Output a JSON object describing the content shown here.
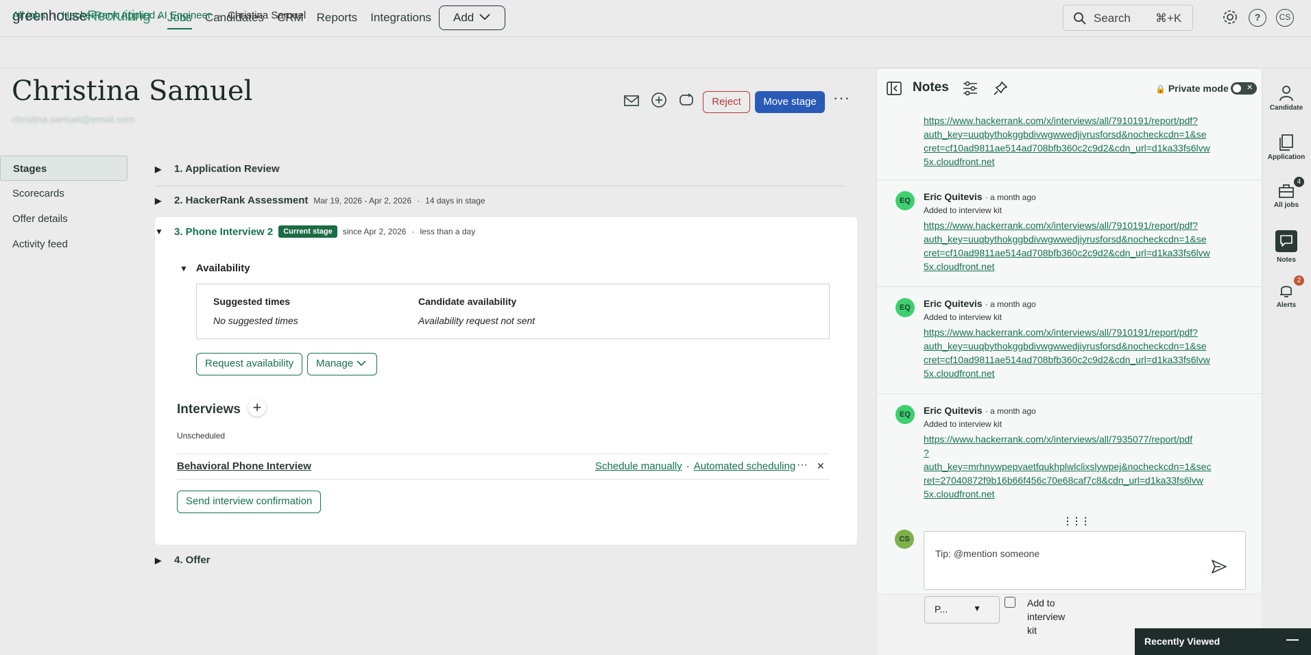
{
  "app": {
    "logo_primary": "greenhouse",
    "logo_secondary": "Recruiting",
    "nav": [
      "Jobs",
      "Candidates",
      "CRM",
      "Reports",
      "Integrations"
    ],
    "add_label": "Add",
    "search_label": "Search",
    "search_shortcut": "⌘+K",
    "user_initials": "CS"
  },
  "breadcrumb": [
    "All jobs",
    "HackerRank Applied AI Engineer",
    "Christina Samuel"
  ],
  "candidate": {
    "name": "Christina Samuel",
    "email": "christina.samuel@email.com"
  },
  "actions": {
    "reject": "Reject",
    "move_stage": "Move stage"
  },
  "left_nav": [
    "Stages",
    "Scorecards",
    "Offer details",
    "Activity feed"
  ],
  "stages": [
    {
      "label": "1. Application Review",
      "dates": "",
      "duration": ""
    },
    {
      "label": "2. HackerRank Assessment",
      "dates": "Mar 19, 2026 - Apr 2, 2026",
      "duration": "14 days in stage"
    },
    {
      "label": "3. Phone Interview 2",
      "badge": "Current stage",
      "dates": "since Apr 2, 2026",
      "duration": "less than a day"
    },
    {
      "label": "4. Offer"
    }
  ],
  "availability": {
    "title": "Availability",
    "suggested_title": "Suggested times",
    "suggested_value": "No suggested times",
    "candidate_title": "Candidate availability",
    "candidate_value": "Availability request not sent",
    "request_button": "Request availability",
    "manage_button": "Manage"
  },
  "interviews": {
    "title": "Interviews",
    "status": "Unscheduled",
    "name": "Behavioral Phone Interview",
    "schedule_manually": "Schedule manually",
    "automated": "Automated scheduling",
    "send_confirmation": "Send interview confirmation"
  },
  "notes": {
    "title": "Notes",
    "private_mode": "Private mode",
    "items": [
      {
        "author": "",
        "when": "",
        "sub": "",
        "link": "https://www.hackerrank.com/x/interviews/all/7910191/report/pdf?\nauth_key=uuqbythokggbdivwgwwedjiyrusforsd&nocheckcdn=1&se\ncret=cf10ad9811ae514ad708bfb360c2c9d2&cdn_url=d1ka33fs6lvw\n5x.cloudfront.net"
      },
      {
        "initials": "EQ",
        "author": "Eric Quitevis",
        "when": "a month ago",
        "sub": "Added to interview kit",
        "link": "https://www.hackerrank.com/x/interviews/all/7910191/report/pdf?\nauth_key=uuqbythokggbdivwgwwedjiyrusforsd&nocheckcdn=1&se\ncret=cf10ad9811ae514ad708bfb360c2c9d2&cdn_url=d1ka33fs6lvw\n5x.cloudfront.net"
      },
      {
        "initials": "EQ",
        "author": "Eric Quitevis",
        "when": "a month ago",
        "sub": "Added to interview kit",
        "link": "https://www.hackerrank.com/x/interviews/all/7910191/report/pdf?\nauth_key=uuqbythokggbdivwgwwedjiyrusforsd&nocheckcdn=1&se\ncret=cf10ad9811ae514ad708bfb360c2c9d2&cdn_url=d1ka33fs6lvw\n5x.cloudfront.net"
      },
      {
        "initials": "EQ",
        "author": "Eric Quitevis",
        "when": "a month ago",
        "sub": "Added to interview kit",
        "link": "https://www.hackerrank.com/x/interviews/all/7935077/report/pdf\n?\nauth_key=mrhnywpepvaetfqukhplwlclixslywpej&nocheckcdn=1&sec\nret=27040872f9b16b66f456c70e68caf7c8&cdn_url=d1ka33fs6lvw\n5x.cloudfront.net"
      }
    ],
    "composer_placeholder": "Tip: @mention someone",
    "composer_initials": "CS",
    "under_select": "P...",
    "under_checkbox": "Add to interview kit"
  },
  "rail": [
    {
      "label": "Candidate",
      "icon": "person-icon"
    },
    {
      "label": "Application",
      "icon": "document-icon"
    },
    {
      "label": "All jobs",
      "icon": "briefcase-icon",
      "badge": "4"
    },
    {
      "label": "Notes",
      "icon": "notes-icon"
    },
    {
      "label": "Alerts",
      "icon": "bell-icon",
      "badge": "2"
    }
  ],
  "recently_viewed": "Recently Viewed"
}
